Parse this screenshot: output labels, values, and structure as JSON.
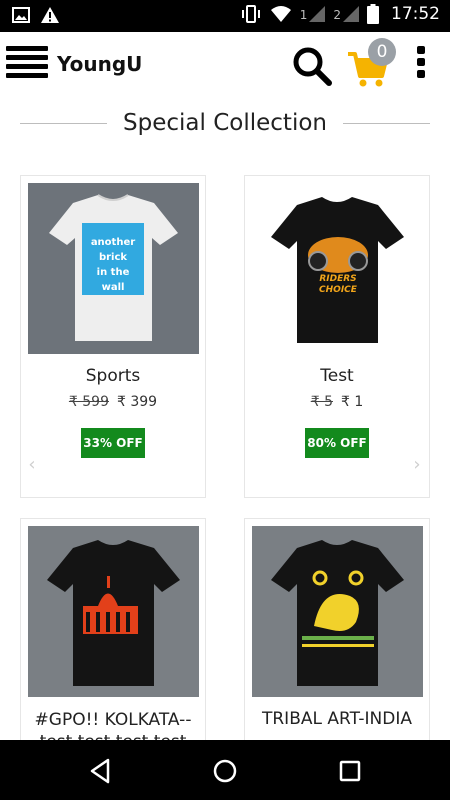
{
  "status_bar": {
    "sim1": "1",
    "sim2": "2",
    "time": "17:52"
  },
  "app_bar": {
    "brand": "YoungU",
    "cart_count": "0"
  },
  "section": {
    "title": "Special Collection"
  },
  "products": [
    {
      "name": "Sports",
      "old_price": "₹ 599",
      "price": "₹ 399",
      "discount": "33% OFF",
      "print_text": "another brick in the wall"
    },
    {
      "name": "Test",
      "old_price": "₹ 5",
      "price": "₹ 1",
      "discount": "80% OFF",
      "print_text": "RIDERS CHOICE"
    },
    {
      "name": "#GPO!! KOLKATA--test test test test",
      "old_price": "",
      "price": "",
      "discount": ""
    },
    {
      "name": "TRIBAL ART-INDIA",
      "old_price": "",
      "price": "",
      "discount": ""
    }
  ],
  "colors": {
    "discount_badge": "#138a1d",
    "cart_icon": "#f5b301",
    "cart_badge": "#9aa0a6",
    "status_bar": "#000000"
  },
  "icons": {
    "menu": "menu-icon",
    "search": "search-icon",
    "cart": "cart-icon",
    "more": "more-vert-icon",
    "back": "back-icon",
    "home": "home-icon",
    "recent": "recent-apps-icon"
  }
}
